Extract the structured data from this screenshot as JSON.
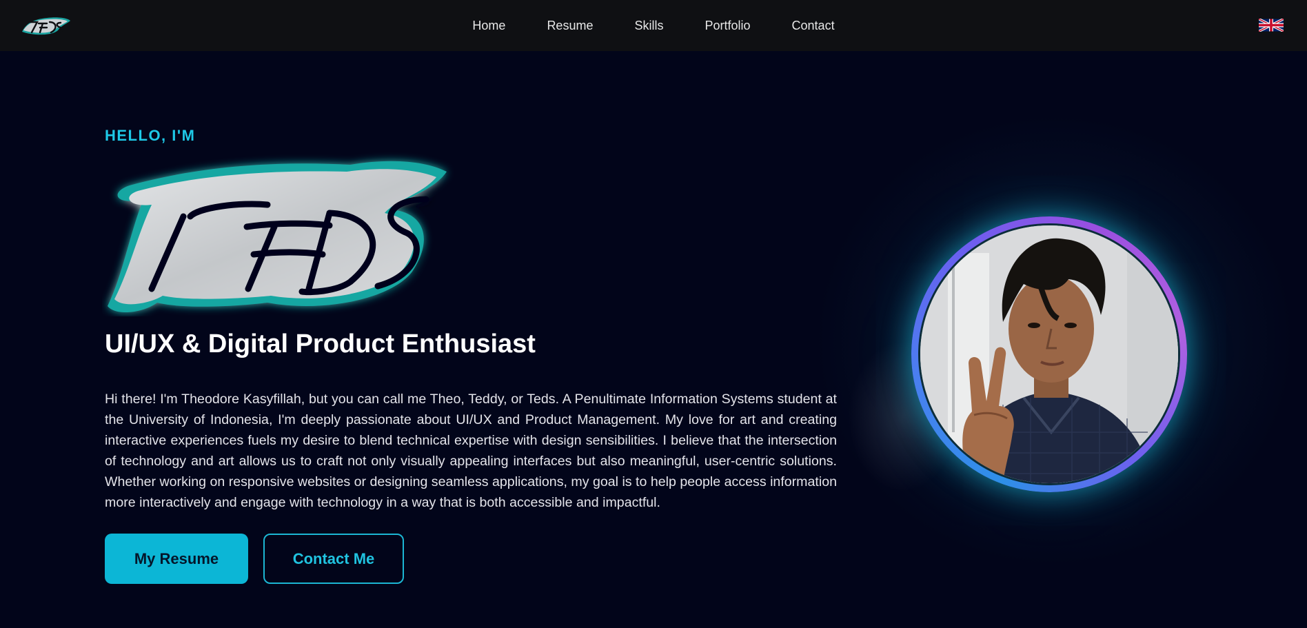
{
  "nav": {
    "logo_text": "TEDS",
    "links": [
      "Home",
      "Resume",
      "Skills",
      "Portfolio",
      "Contact"
    ],
    "language_icon": "uk-flag-icon"
  },
  "hero": {
    "greeting": "HELLO, I'M",
    "logo_text": "TEDS",
    "tagline": "UI/UX & Digital Product Enthusiast",
    "bio": "Hi there! I'm Theodore Kasyfillah, but you can call me Theo, Teddy, or Teds. A Penultimate Information Systems student at the University of Indonesia, I'm deeply passionate about UI/UX and Product Management. My love for art and creating interactive experiences fuels my desire to blend technical expertise with design sensibilities. I believe that the intersection of technology and art allows us to craft not only visually appealing interfaces but also meaningful, user-centric solutions. Whether working on responsive websites or designing seamless applications, my goal is to help people access information more interactively and engage with technology in a way that is both accessible and impactful.",
    "primary_button": "My Resume",
    "secondary_button": "Contact Me"
  },
  "colors": {
    "accent": "#1ec8e6",
    "background": "#02051a",
    "navbar": "#0f1013",
    "button_primary": "#0cb6d6",
    "ring_start": "#2e8fe8",
    "ring_end": "#b060e0"
  }
}
